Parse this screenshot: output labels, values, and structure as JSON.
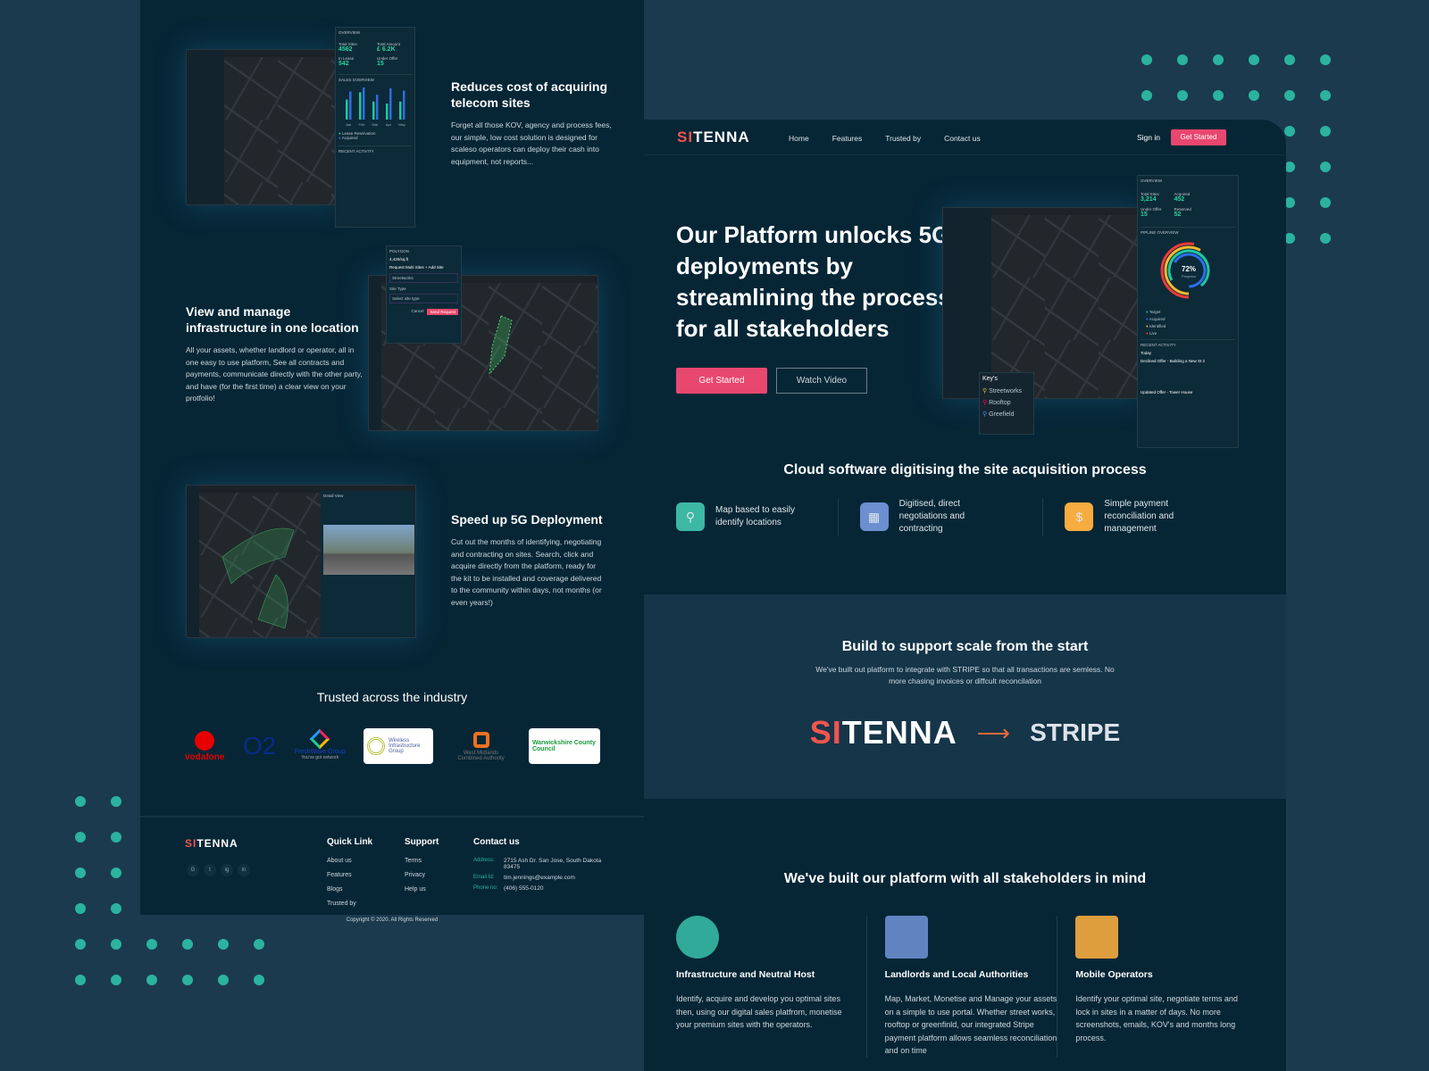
{
  "brand": {
    "name_part1": "SI",
    "name_part2": "TENNA",
    "accent": "#e8476f",
    "teal": "#2bb3a0"
  },
  "nav": {
    "items": [
      "Home",
      "Features",
      "Trusted by",
      "Contact us"
    ],
    "sign_in": "Sign in",
    "get_started": "Get Started"
  },
  "hero": {
    "title": "Our Platform unlocks 5G deployments by streamlining the process, for all stakeholders",
    "primary": "Get Started",
    "secondary": "Watch Video"
  },
  "dashboard": {
    "overview": "OVERVIEW",
    "stats": [
      {
        "label": "Total Sites",
        "value": "3,214"
      },
      {
        "label": "Acquired",
        "value": "452"
      },
      {
        "label": "Under Offer",
        "value": "15"
      },
      {
        "label": "Reserved",
        "value": "52"
      }
    ],
    "pipeline": "PIPLINE OVERVIEW",
    "progress_value": "72%",
    "progress_label": "Progress",
    "legend": [
      "Target",
      "Acquired",
      "Identified",
      "Live"
    ],
    "recent": "RECENT ACTIVITY",
    "today": "Today",
    "act1": "Declined Offer - Building a New St 2",
    "act2": "Updated Offer - Tower House",
    "keys_title": "Key's",
    "keys": [
      "Streetworks",
      "Rooftop",
      "Greefield"
    ]
  },
  "cloud": {
    "title": "Cloud software digitising the site acquisition process",
    "features": [
      {
        "icon": "map-pin-icon",
        "text": "Map based to easily identify locations",
        "color": "#3db8a4"
      },
      {
        "icon": "grid-nodes-icon",
        "text": "Digitised, direct negotiations and contracting",
        "color": "#6b8fd0"
      },
      {
        "icon": "payment-hand-icon",
        "text": "Simple payment reconciliation and management",
        "color": "#f6ac3f"
      }
    ]
  },
  "scale": {
    "title": "Build to support scale from the start",
    "text": "We've built out platform to integrate with STRIPE so that all transactions are semless. No more chasing invoices or diffcult reconcilation",
    "stripe": "STRIPE"
  },
  "stakeholders": {
    "title": "We've built our platform with all stakeholders in mind",
    "items": [
      {
        "icon": "gear-network-icon",
        "title": "Infrastructure and Neutral Host",
        "text": "Identify, acquire and develop you optimal sites then, using our digital sales platfrom, monetise your premium sites with the operators."
      },
      {
        "icon": "people-target-icon",
        "title": "Landlords and Local Authorities",
        "text": "Map, Market, Monetise and Manage your assets on a simple to use portal. Whether street works, rooftop or greenfinld, our integrated Stripe payment platform allows seamless reconciliation and on time"
      },
      {
        "icon": "mobile-browser-icon",
        "title": "Mobile Operators",
        "text": "Identify your optimal site, negotiate terms and lock in sites in a matter of days. No more screenshots, emails, KOV's and months long process."
      }
    ]
  },
  "left": {
    "sec1": {
      "title": "Reduces cost of acquiring telecom sites",
      "text": "Forget all those KOV, agency and process fees, our simple, low cost solution is designed for scaleso operators can deploy their cash into equipment, not reports..."
    },
    "sec2": {
      "title": "View and manage infrastructure in one location",
      "text": "All your assets, whether landlord or operator, all in one easy to use platform, See all contracts and payments, communicate directly with the other party, and have (for the first time) a clear view on your protfolio!"
    },
    "sec3": {
      "title": "Speed up 5G Deployment",
      "text": "Cut out the months of identifying, negotiating and contracting on sites. Search, click and acquire directly from the platform, ready for the kit to be installed and coverage delivered to the community within days, not months (or even years!)"
    },
    "mock1": {
      "overview": "OVERVIEW",
      "stats": [
        {
          "label": "Total Sites",
          "value": "4562"
        },
        {
          "label": "Total Amount",
          "value": "£ 6.2K"
        },
        {
          "label": "In Lease",
          "value": "542"
        },
        {
          "label": "Under Offer",
          "value": "15"
        }
      ],
      "sales": "SALES OVERVIEW",
      "months": [
        "Jan",
        "Feb",
        "Mar",
        "Apr",
        "May"
      ],
      "series1": [
        50,
        68,
        45,
        40,
        45
      ],
      "series2": [
        70,
        80,
        62,
        78,
        72
      ],
      "legend": [
        "Lease Reservation",
        "Acquired"
      ],
      "recent": "RECENT ACTIVITY"
    },
    "mock2": {
      "polygon": "POLYGON",
      "area": "4,420/sq.ft",
      "request": "Request Multi Sites",
      "add": "+ Add Site",
      "field": "Streetworks",
      "site_type": "Site Type",
      "select": "Select site type",
      "cancel": "Cancel",
      "send": "Send Request"
    },
    "mock3": {
      "detail": "Detail View"
    },
    "trusted": {
      "title": "Trusted across the industry",
      "logos": [
        "vodafone",
        "O2",
        "FreshWave Group",
        "Wireless Infrastructure Group",
        "West Midlands Combined Authority",
        "Warwickshire County Council"
      ],
      "freshwave_tag": "You've got network"
    }
  },
  "footer": {
    "quick_title": "Quick Link",
    "quick": [
      "About us",
      "Features",
      "Blogs",
      "Trusted by"
    ],
    "support_title": "Support",
    "support": [
      "Terms",
      "Privacy",
      "Help us"
    ],
    "contact_title": "Contact us",
    "contact": [
      {
        "label": "Address:",
        "value": "2715 Ash Dr. San Jose, South Dakota 83475"
      },
      {
        "label": "Email Id:",
        "value": "tim.jennings@example.com"
      },
      {
        "label": "Phone no:",
        "value": "(406) 555-0120"
      }
    ],
    "social": [
      "G",
      "t",
      "ig",
      "in"
    ],
    "copyright": "Copyright © 2020. All Rights Reserved"
  }
}
